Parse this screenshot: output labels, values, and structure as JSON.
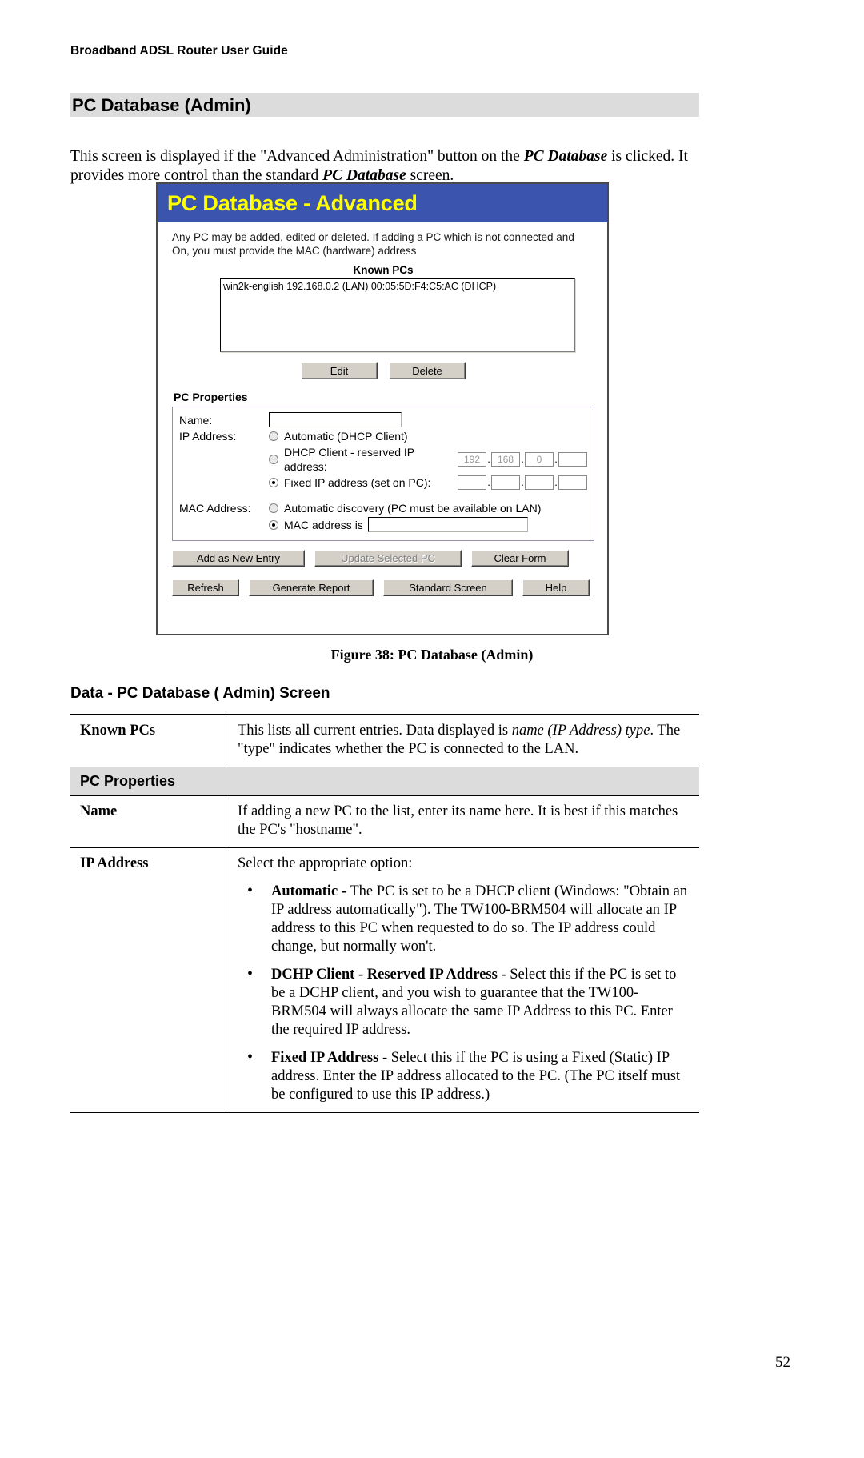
{
  "header": {
    "running_title": "Broadband ADSL Router User Guide",
    "page_number": "52"
  },
  "section": {
    "title": "PC Database (Admin)",
    "intro_part1": "This screen is displayed if the \"Advanced Administration\" button on the ",
    "intro_em1": "PC Database",
    "intro_part2": " is clicked. It provides more control than the standard ",
    "intro_em2": "PC Database",
    "intro_part3": " screen."
  },
  "screenshot": {
    "title": "PC Database - Advanced",
    "description": "Any PC may be added, edited or deleted. If adding a PC which is not connected and On, you must provide the MAC (hardware) address",
    "known_pcs_label": "Known PCs",
    "known_pcs_entries": [
      "win2k-english 192.168.0.2 (LAN) 00:05:5D:F4:C5:AC (DHCP)"
    ],
    "edit_button": "Edit",
    "delete_button": "Delete",
    "pc_properties_label": "PC Properties",
    "name_label": "Name:",
    "name_value": "",
    "ip_address_label": "IP Address:",
    "ip_option_automatic": "Automatic (DHCP Client)",
    "ip_option_dhcp_reserved": "DHCP Client - reserved IP address:",
    "ip_option_fixed": "Fixed IP address (set on PC):",
    "dhcp_reserved_octets": [
      "192",
      "168",
      "0",
      ""
    ],
    "fixed_octets": [
      "",
      "",
      "",
      ""
    ],
    "mac_address_label": "MAC Address:",
    "mac_option_auto": "Automatic discovery (PC must be available on LAN)",
    "mac_option_manual": "MAC address is",
    "mac_value": "",
    "selected_ip_option": "fixed",
    "selected_mac_option": "manual",
    "add_as_new_entry_button": "Add as New Entry",
    "update_selected_pc_button": "Update Selected PC",
    "clear_form_button": "Clear Form",
    "refresh_button": "Refresh",
    "generate_report_button": "Generate Report",
    "standard_screen_button": "Standard Screen",
    "help_button": "Help",
    "title_bar_color": "#3b54ad",
    "title_text_color": "#ffff00"
  },
  "figure_caption": "Figure 38: PC Database (Admin)",
  "data_section": {
    "heading": "Data - PC Database ( Admin) Screen",
    "rows": [
      {
        "term": "Known PCs",
        "text_part1": "This lists all current entries. Data displayed is ",
        "text_em": "name (IP Address) type",
        "text_part2": ". The \"type\" indicates whether the PC is connected to the LAN."
      },
      {
        "subhead": "PC Properties"
      },
      {
        "term": "Name",
        "text": "If adding a new PC to the list, enter its name here. It is best if this matches the PC's \"hostname\"."
      },
      {
        "term": "IP Address",
        "text": "Select the appropriate option:",
        "bullets": [
          {
            "label": "Automatic -",
            "body": " The PC is set to be a DHCP client (Windows: \"Obtain an IP address automatically\"). The TW100-BRM504 will allocate an IP address to this PC when requested to do so. The IP address could change, but normally won't."
          },
          {
            "label": "DCHP Client - Reserved IP Address -",
            "body": " Select this if the PC is set to be a DCHP client, and you wish to guarantee that the TW100-BRM504 will always allocate the same IP Address to this PC. Enter the required IP address."
          },
          {
            "label": "Fixed IP Address -",
            "body": " Select this if the PC is using a Fixed (Static) IP address. Enter the IP address allocated to the PC. (The PC itself must be configured to use this IP address.)"
          }
        ]
      }
    ]
  }
}
